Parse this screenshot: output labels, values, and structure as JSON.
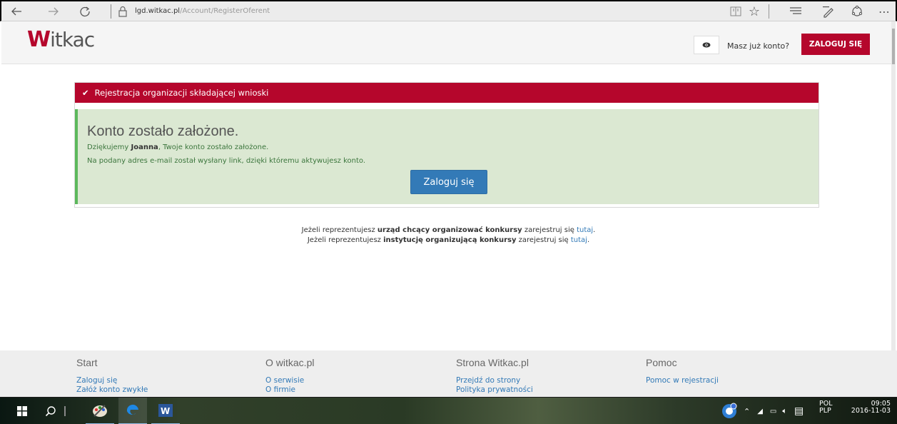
{
  "browser": {
    "url_domain": "lgd.witkac.pl",
    "url_path": "/Account/RegisterOferent"
  },
  "header": {
    "logo_text": "itkac",
    "logo_initial": "W",
    "have_account": "Masz już konto?",
    "login_label": "ZALOGUJ SIĘ"
  },
  "panel": {
    "title": "Rejestracja organizacji składającej wnioski",
    "success_heading": "Konto zostało założone.",
    "thanks_prefix": "Dziękujemy ",
    "user_name": "Joanna",
    "thanks_suffix": ", Twoje konto zostało założone.",
    "email_info": "Na podany adres e-mail został wysłany link, dzięki któremu aktywujesz konto.",
    "login_button": "Zaloguj się"
  },
  "info": {
    "line1_prefix": "Jeżeli reprezentujesz ",
    "line1_bold": "urząd chcący organizować konkursy",
    "line1_suffix": " zarejestruj się ",
    "line1_link": "tutaj",
    "line2_prefix": "Jeżeli reprezentujesz ",
    "line2_bold": "instytucję organizującą konkursy",
    "line2_suffix": " zarejestruj się ",
    "line2_link": "tutaj",
    "dot": "."
  },
  "footer": {
    "columns": [
      {
        "title": "Start",
        "links": [
          "Zaloguj się",
          "Załóż konto zwykłe"
        ]
      },
      {
        "title": "O witkac.pl",
        "links": [
          "O serwisie",
          "O firmie"
        ]
      },
      {
        "title": "Strona Witkac.pl",
        "links": [
          "Przejdź do strony",
          "Polityka prywatności"
        ]
      },
      {
        "title": "Pomoc",
        "links": [
          "Pomoc w rejestracji"
        ]
      }
    ]
  },
  "taskbar": {
    "language": "POL",
    "layout": "PLP",
    "time": "09:05",
    "date": "2016-11-03"
  },
  "colors": {
    "brand": "#b5062c",
    "success_bg": "#dbe8d2",
    "primary": "#337ab7"
  }
}
